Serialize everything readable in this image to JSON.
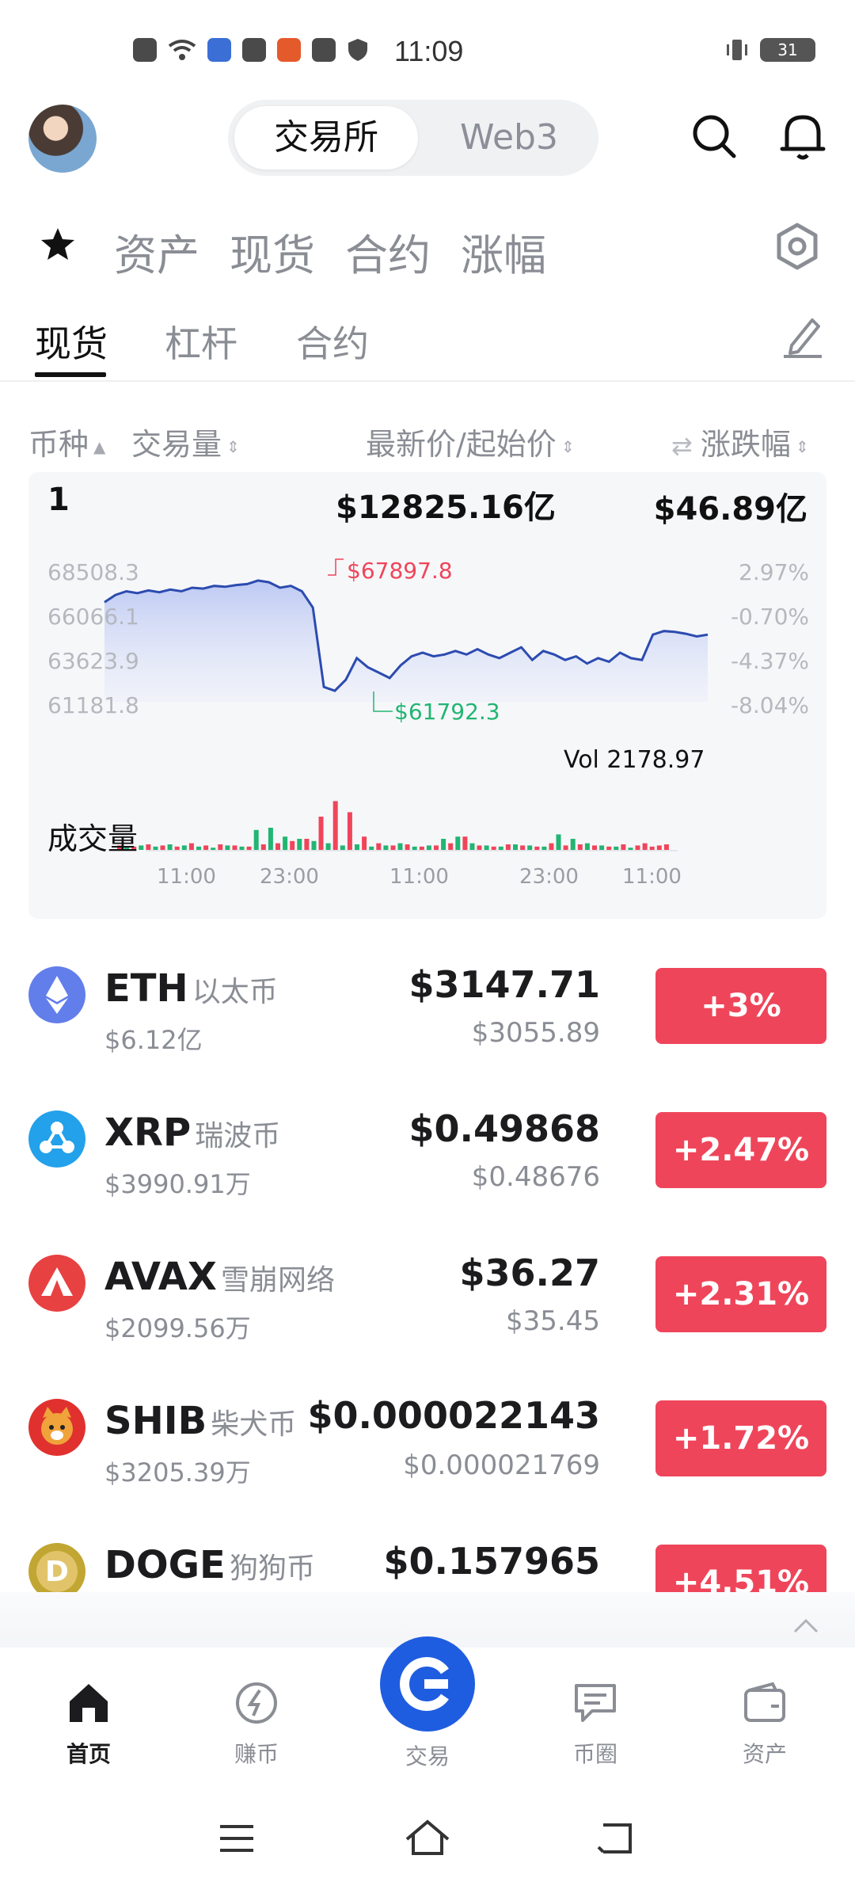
{
  "status_bar": {
    "time": "11:09",
    "battery": "31",
    "icons": [
      "close-icon",
      "wifi-icon",
      "app-icon",
      "app-icon",
      "app-icon",
      "play-icon",
      "shield-icon"
    ]
  },
  "header": {
    "segment": [
      "交易所",
      "Web3"
    ],
    "icons": [
      "search-icon",
      "bell-icon"
    ]
  },
  "category_tabs": [
    "资产",
    "现货",
    "合约",
    "涨幅"
  ],
  "sub_tabs": [
    "现货",
    "杠杆",
    "合约"
  ],
  "columns": {
    "coin": "币种",
    "volume": "交易量",
    "price": "最新价/起始价",
    "change": "涨跌幅"
  },
  "chart_card": {
    "rank": "1",
    "market_cap": "$12825.16亿",
    "volume": "$46.89亿",
    "vol_label": "Vol 2178.97",
    "volume_label": "成交量",
    "high_label": "$67897.8",
    "low_label": "$61792.3",
    "y_labels": [
      "68508.3",
      "66066.1",
      "63623.9",
      "61181.8"
    ],
    "pct_labels": [
      "2.97%",
      "-0.70%",
      "-4.37%",
      "-8.04%"
    ],
    "x_labels": [
      "11:00",
      "23:00",
      "11:00",
      "23:00",
      "11:00"
    ]
  },
  "chart_data": {
    "type": "line",
    "title": "",
    "ylim": [
      61181.8,
      68508.3
    ],
    "y_ticks": [
      68508.3,
      66066.1,
      63623.9,
      61181.8
    ],
    "x_ticks": [
      "11:00",
      "23:00",
      "11:00",
      "23:00",
      "11:00"
    ],
    "series": [
      {
        "values": [
          66700,
          67100,
          67300,
          67200,
          67350,
          67250,
          67400,
          67300,
          67500,
          67450,
          67600,
          67550,
          67650,
          67700,
          67898,
          67800,
          67500,
          67600,
          67300,
          66400,
          62000,
          61792,
          62400,
          63600,
          63100,
          62800,
          62500,
          63200,
          63700,
          63900,
          63700,
          63800,
          64000,
          63800,
          64100,
          63800,
          63600,
          63900,
          64200,
          63500,
          64000,
          63800,
          63500,
          63700,
          63300,
          63600,
          63400,
          63900,
          63600,
          63500,
          64900,
          65100,
          65050,
          64950,
          64800,
          64900
        ]
      }
    ],
    "volume_bars_red": [
      4,
      3,
      5,
      4,
      3,
      6,
      4,
      5,
      4,
      3,
      5,
      6,
      8,
      10,
      30,
      44,
      34,
      12,
      6,
      4,
      5,
      3,
      4,
      6,
      12,
      4,
      3,
      5,
      4,
      3,
      6,
      4,
      5,
      4,
      3,
      5,
      4,
      6,
      3,
      4,
      5
    ],
    "volume_bars_green": [
      3,
      4,
      3,
      5,
      4,
      3,
      2,
      4,
      3,
      18,
      20,
      12,
      10,
      8,
      6,
      4,
      5,
      3,
      4,
      6,
      3,
      4,
      10,
      12,
      6,
      4,
      3,
      5,
      4,
      3,
      14,
      10,
      6,
      4,
      3,
      2
    ]
  },
  "coins": [
    {
      "symbol": "ETH",
      "name": "以太币",
      "volume": "$6.12亿",
      "price": "$3147.71",
      "start": "$3055.89",
      "change": "+3%",
      "color": "#627eea",
      "icon": "eth-icon"
    },
    {
      "symbol": "XRP",
      "name": "瑞波币",
      "volume": "$3990.91万",
      "price": "$0.49868",
      "start": "$0.48676",
      "change": "+2.47%",
      "color": "#23a1ea",
      "icon": "xrp-icon"
    },
    {
      "symbol": "AVAX",
      "name": "雪崩网络",
      "volume": "$2099.56万",
      "price": "$36.27",
      "start": "$35.45",
      "change": "+2.31%",
      "color": "#e84142",
      "icon": "avax-icon"
    },
    {
      "symbol": "SHIB",
      "name": "柴犬币",
      "volume": "$3205.39万",
      "price": "$0.000022143",
      "start": "$0.000021769",
      "change": "+1.72%",
      "color": "#f0a33a",
      "icon": "shib-icon"
    },
    {
      "symbol": "DOGE",
      "name": "狗狗币",
      "volume": "",
      "price": "$0.157965",
      "start": "",
      "change": "+4.51%",
      "color": "#c2a633",
      "icon": "doge-icon"
    }
  ],
  "bottom_nav": [
    {
      "label": "首页",
      "icon": "home-icon",
      "active": true
    },
    {
      "label": "赚币",
      "icon": "earn-icon",
      "active": false
    },
    {
      "label": "交易",
      "icon": "trade-icon",
      "active": false
    },
    {
      "label": "币圈",
      "icon": "community-icon",
      "active": false
    },
    {
      "label": "资产",
      "icon": "wallet-icon",
      "active": false
    }
  ],
  "colors": {
    "accent": "#1f6feb",
    "up": "#ef455a",
    "down": "#22b573",
    "line": "#2c4bb0"
  }
}
